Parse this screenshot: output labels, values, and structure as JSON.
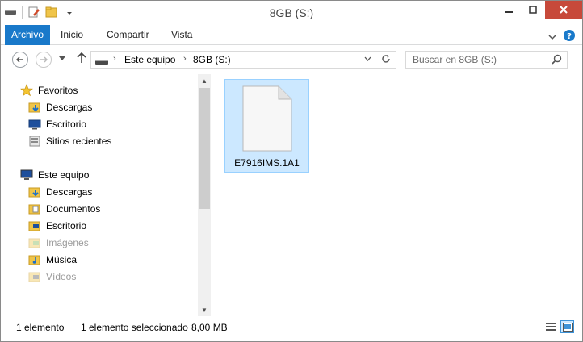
{
  "window": {
    "title": "8GB (S:)"
  },
  "quick_access": [
    {
      "icon": "properties-icon"
    },
    {
      "icon": "new-folder-icon"
    },
    {
      "icon": "customize-dropdown-icon"
    }
  ],
  "ribbon": {
    "tabs": [
      "Archivo",
      "Inicio",
      "Compartir",
      "Vista"
    ]
  },
  "address": {
    "segments": [
      "Este equipo",
      "8GB (S:)"
    ]
  },
  "search": {
    "placeholder": "Buscar en 8GB (S:)"
  },
  "nav_pane": {
    "favorites": {
      "label": "Favoritos",
      "items": [
        "Descargas",
        "Escritorio",
        "Sitios recientes"
      ]
    },
    "this_pc": {
      "label": "Este equipo",
      "items": [
        "Descargas",
        "Documentos",
        "Escritorio",
        "Imágenes",
        "Música",
        "Vídeos"
      ]
    }
  },
  "files": [
    {
      "name": "E7916IMS.1A1"
    }
  ],
  "status": {
    "count": "1 elemento",
    "selected": "1 elemento seleccionado",
    "size": "8,00 MB"
  },
  "colors": {
    "file_tab": "#1979ca",
    "close_button": "#c7493a",
    "selection": "#cce8ff"
  }
}
